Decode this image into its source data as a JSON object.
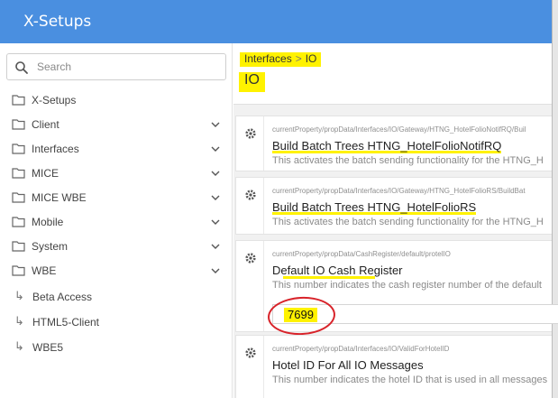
{
  "app": {
    "title": "X-Setups"
  },
  "search": {
    "placeholder": "Search"
  },
  "sidebar": {
    "root": "X-Setups",
    "items": [
      {
        "label": "Client"
      },
      {
        "label": "Interfaces"
      },
      {
        "label": "MICE"
      },
      {
        "label": "MICE WBE"
      },
      {
        "label": "Mobile"
      },
      {
        "label": "System"
      },
      {
        "label": "WBE"
      }
    ],
    "sub_items": [
      {
        "label": "Beta Access"
      },
      {
        "label": "HTML5-Client"
      },
      {
        "label": "WBE5"
      }
    ]
  },
  "breadcrumb": {
    "parent": "Interfaces",
    "separator": ">",
    "current": "IO"
  },
  "page": {
    "title": "IO"
  },
  "settings": [
    {
      "path": "currentProperty/propData/Interfaces/IO/Gateway/HTNG_HotelFolioNotifRQ/Buil",
      "name": "Build Batch Trees HTNG_HotelFolioNotifRQ",
      "description": "This activates the batch sending functionality for the HTNG_H"
    },
    {
      "path": "currentProperty/propData/Interfaces/IO/Gateway/HTNG_HotelFolioRS/BuildBat",
      "name": "Build Batch Trees HTNG_HotelFolioRS",
      "description": "This activates the batch sending functionality for the HTNG_H"
    },
    {
      "path": "currentProperty/propData/CashRegister/default/protelIO",
      "name": "Default IO Cash Register",
      "description": "This number indicates the cash register number of the default",
      "value": "7699"
    },
    {
      "path": "currentProperty/propData/Interfaces/IO/ValidForHotelID",
      "name": "Hotel ID For All IO Messages",
      "description": "This number indicates the hotel ID that is used in all messages"
    }
  ],
  "colors": {
    "header": "#4a8fe0",
    "highlight": "#fff200",
    "annotation": "#d8232a"
  },
  "icons": {
    "search": "search-icon",
    "folder": "folder-icon",
    "chevron": "chevron-down-icon",
    "gear": "gear-icon",
    "sub": "sub-item-arrow-icon"
  }
}
